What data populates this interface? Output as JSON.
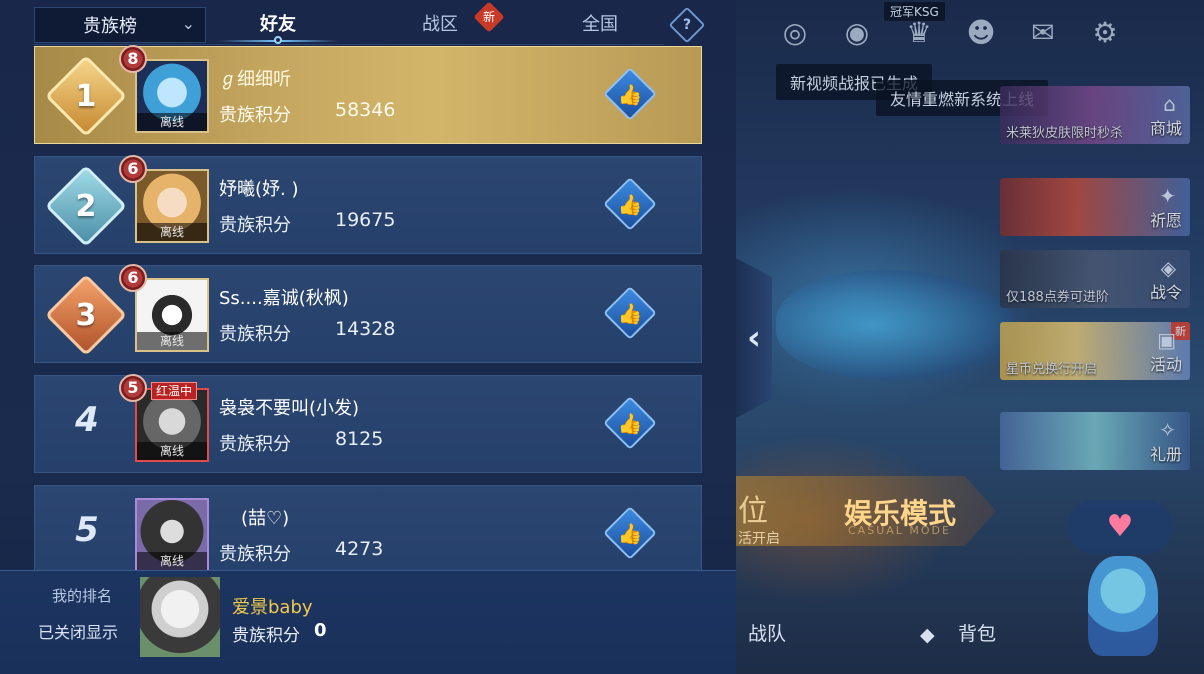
{
  "header": {
    "ranking_select": "贵族榜",
    "tabs": [
      {
        "label": "好友",
        "active": true
      },
      {
        "label": "战区",
        "badge": "新"
      },
      {
        "label": "全国"
      }
    ],
    "help": "?"
  },
  "rows": [
    {
      "rank": "1",
      "level": "8",
      "name": "ℊ细细听",
      "points_label": "贵族积分",
      "points": "58346",
      "status": "离线"
    },
    {
      "rank": "2",
      "level": "6",
      "name": "妤曦(妤. )",
      "points_label": "贵族积分",
      "points": "19675",
      "status": "离线"
    },
    {
      "rank": "3",
      "level": "6",
      "name": "Ss....嘉诚(秋枫)",
      "points_label": "贵族积分",
      "points": "14328",
      "status": "离线"
    },
    {
      "rank": "4",
      "level": "5",
      "tag": "红温中",
      "name": "袅袅不要叫(小发)",
      "points_label": "贵族积分",
      "points": "8125",
      "status": "离线"
    },
    {
      "rank": "5",
      "name": "(喆♡)",
      "points_label": "贵族积分",
      "points": "4273",
      "status": "离线"
    }
  ],
  "my_rank": {
    "title": "我的排名",
    "status": "已关闭显示",
    "name": "爱景baby",
    "points_label": "贵族积分",
    "points": "0"
  },
  "lobby": {
    "chips": [
      "新视频战报已生成",
      "友情重燃新系统上线"
    ],
    "side_cards": [
      {
        "text": "米莱狄皮肤限时秒杀",
        "label": "商城"
      },
      {
        "text": "",
        "label": "祈愿"
      },
      {
        "text": "仅188点券可进阶",
        "label": "战令"
      },
      {
        "text": "星币兑换行开启",
        "label": "活动",
        "badge": "新"
      },
      {
        "text": "",
        "label": "礼册"
      }
    ],
    "mode_left": "位",
    "mode_left_sub": "活开启",
    "mode_title": "娱乐模式",
    "mode_sub": "CASUAL MODE",
    "bottom": [
      "战队",
      "背包"
    ],
    "top_tag": "冠军KSG"
  },
  "colors": {
    "panel_bg": "#1a2b4e",
    "row_bg": "#2b4670",
    "first_row_gold": "#c7a961",
    "like_blue": "#3c8ae0",
    "my_name_gold": "#f2c94c"
  }
}
